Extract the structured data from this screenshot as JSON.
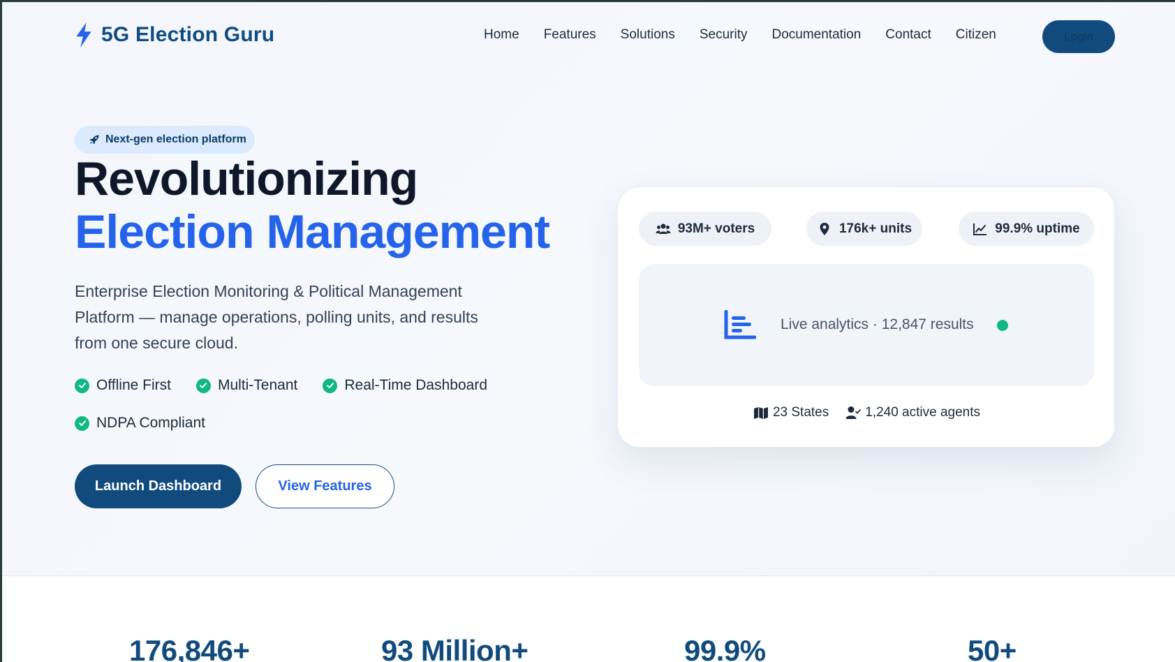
{
  "brand": {
    "name": "5G Election Guru",
    "icon": "lightning-bolt-icon"
  },
  "nav": {
    "items": [
      "Home",
      "Features",
      "Solutions",
      "Security",
      "Documentation",
      "Contact",
      "Citizen"
    ],
    "login_label": "Login"
  },
  "hero": {
    "badge": "Next-gen election platform",
    "badge_icon": "rocket-icon",
    "title_line1": "Revolutionizing",
    "title_line2": "Election Management",
    "description": "Enterprise Election Monitoring & Political Management Platform — manage operations, polling units, and results from one secure cloud.",
    "features": [
      "Offline First",
      "Multi-Tenant",
      "Real-Time Dashboard",
      "NDPA Compliant"
    ],
    "primary_button": "Launch Dashboard",
    "secondary_button": "View Features"
  },
  "card": {
    "pills": [
      {
        "icon": "users-icon",
        "label": "93M+ voters"
      },
      {
        "icon": "map-pin-icon",
        "label": "176k+ units"
      },
      {
        "icon": "line-chart-icon",
        "label": "99.9% uptime"
      }
    ],
    "analytics_text": "Live analytics · 12,847 results",
    "analytics_icon": "bar-chart-icon",
    "footer": [
      {
        "icon": "map-icon",
        "label": "23 States"
      },
      {
        "icon": "user-check-icon",
        "label": "1,240 active agents"
      }
    ]
  },
  "stats": [
    "176,846+",
    "93 Million+",
    "99.9%",
    "50+"
  ],
  "colors": {
    "primary": "#114b7d",
    "accent_blue": "#2563eb",
    "success_green": "#10b981",
    "badge_bg": "#dbeafe"
  }
}
